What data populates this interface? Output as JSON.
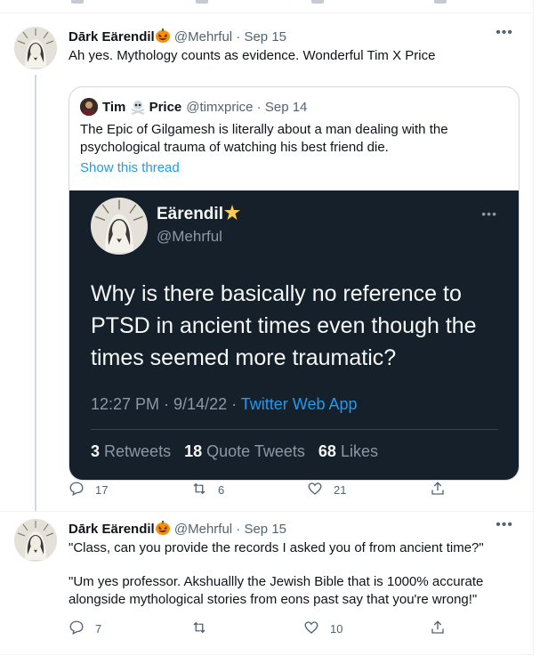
{
  "tweets": [
    {
      "author_name": "Dārk Eärendil",
      "handle_date": "@Mehrful · Sep 15",
      "text": "Ah yes. Mythology counts as evidence. Wonderful Tim X Price",
      "quote": {
        "author_name": "Tim",
        "author_name_suffix": "Price",
        "handle_date": "@timxprice · Sep 14",
        "text": "The Epic of Gilgamesh is literally about a man dealing with the psychological trauma of watching his best friend die.",
        "show_thread": "Show this thread"
      },
      "screenshot": {
        "name": "Eärendil",
        "handle": "@Mehrful",
        "text": "Why is there basically no reference to PTSD in ancient times even though the times seemed more traumatic?",
        "time_date": "12:27 PM · 9/14/22 · ",
        "source": "Twitter Web App",
        "retweets_count": "3",
        "retweets_label": "Retweets",
        "quotes_count": "18",
        "quotes_label": "Quote Tweets",
        "likes_count": "68",
        "likes_label": "Likes"
      },
      "replies": "17",
      "retweets": "6",
      "likes": "21"
    },
    {
      "author_name": "Dārk Eärendil",
      "handle_date": "@Mehrful · Sep 15",
      "text_1": "\"Class, can you provide the records I asked you of from ancient time?\"",
      "text_2": "\"Um yes professor. Akshuallly the Jewish Bible that is 1000% accurate alongside mythological stories from eons past say that you're wrong!\"",
      "replies": "7",
      "retweets": "",
      "likes": "10"
    }
  ],
  "icons": {
    "reply": "reply-icon",
    "retweet": "retweet-icon",
    "like": "heart-icon",
    "share": "share-icon",
    "more": "more-icon",
    "pumpkin": "jack-o-lantern-emoji",
    "sun": "glowing-star-emoji",
    "skull": "skull-crossbones-emoji"
  },
  "colors": {
    "accent": "#1d9bf0",
    "text": "#0f1419",
    "muted": "#536471",
    "dark_bg": "#15202b"
  }
}
